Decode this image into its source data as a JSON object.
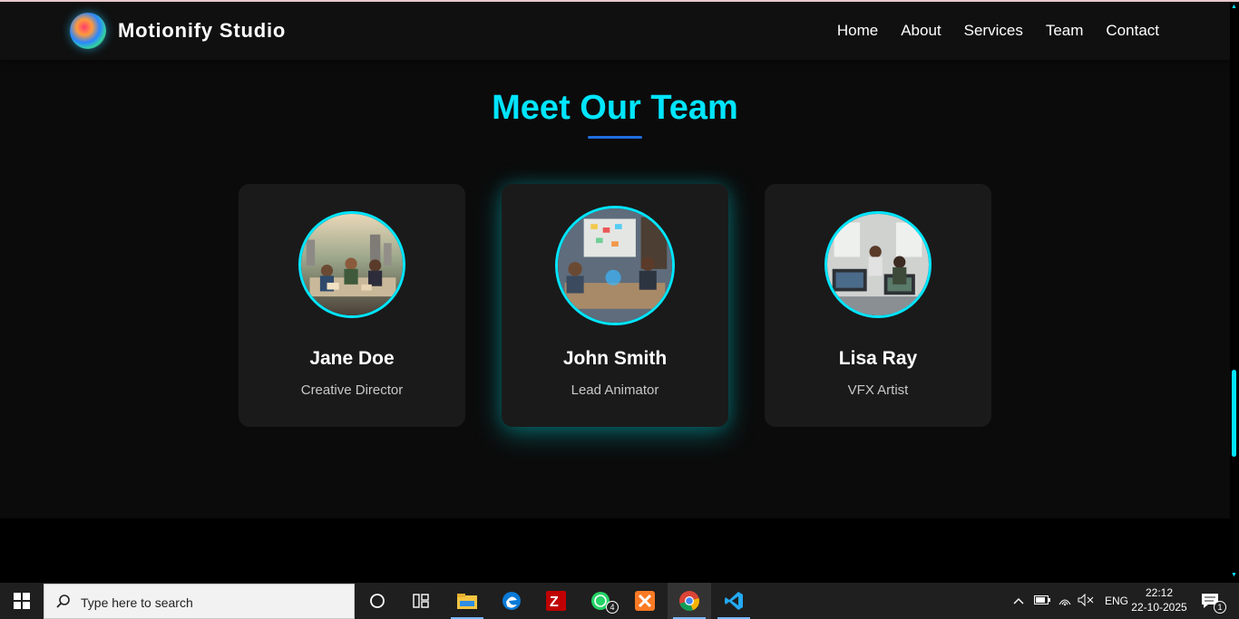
{
  "navbar": {
    "brand": "Motionify Studio",
    "links": [
      "Home",
      "About",
      "Services",
      "Team",
      "Contact"
    ]
  },
  "team": {
    "title": "Meet Our Team",
    "members": [
      {
        "name": "Jane Doe",
        "role": "Creative Director"
      },
      {
        "name": "John Smith",
        "role": "Lead Animator"
      },
      {
        "name": "Lisa Ray",
        "role": "VFX Artist"
      }
    ]
  },
  "taskbar": {
    "search_placeholder": "Type here to search",
    "whatsapp_badge": "4",
    "lang": "ENG",
    "time": "22:12",
    "date": "22-10-2025",
    "notification_count": "1"
  },
  "colors": {
    "accent": "#00e5ff",
    "underline": "#1f6fe0",
    "card_bg": "#1a1a1a",
    "page_bg": "#0b0b0b"
  }
}
